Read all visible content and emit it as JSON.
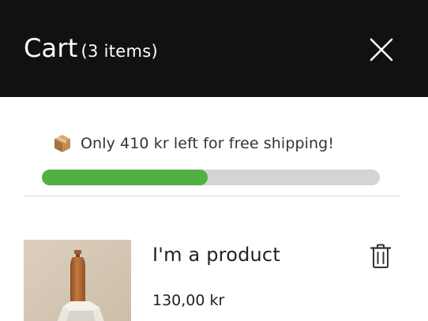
{
  "header": {
    "title": "Cart",
    "item_count": "(3 items)",
    "close_icon": "close-icon"
  },
  "shipping": {
    "icon": "package-box-icon",
    "message": "Only 410 kr left for free shipping!",
    "progress_fraction": 0.49,
    "progress_color": "#52b043",
    "track_color": "#d4d4d4"
  },
  "items": [
    {
      "name": "I'm a product",
      "price": "130,00 kr",
      "image": "copper-water-bottle-photo",
      "remove_icon": "trash-icon"
    }
  ],
  "colors": {
    "header_background": "#111111",
    "header_text": "#ffffff",
    "body_background": "#ffffff"
  }
}
